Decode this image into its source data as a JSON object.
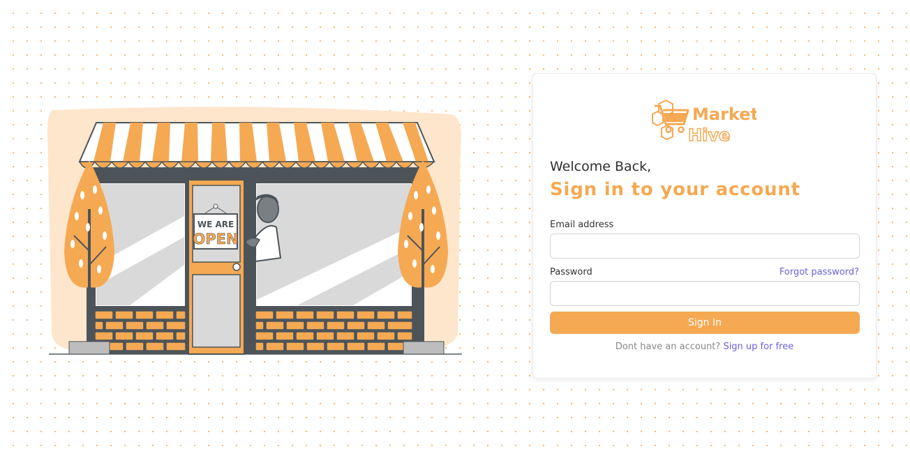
{
  "illustration": {
    "sign_line1": "WE ARE",
    "sign_line2": "OPEN"
  },
  "brand": {
    "name_line1": "Market",
    "name_line2": "Hive",
    "accent": "#f5a953",
    "link": "#6b5fe0"
  },
  "login": {
    "welcome": "Welcome Back,",
    "subtitle": "Sign in to your account",
    "email_label": "Email address",
    "email_value": "",
    "password_label": "Password",
    "password_value": "",
    "forgot_link": "Forgot password?",
    "signin_button": "Sign In",
    "signup_prompt": "Dont have an account?",
    "signup_link": "Sign up for free"
  }
}
